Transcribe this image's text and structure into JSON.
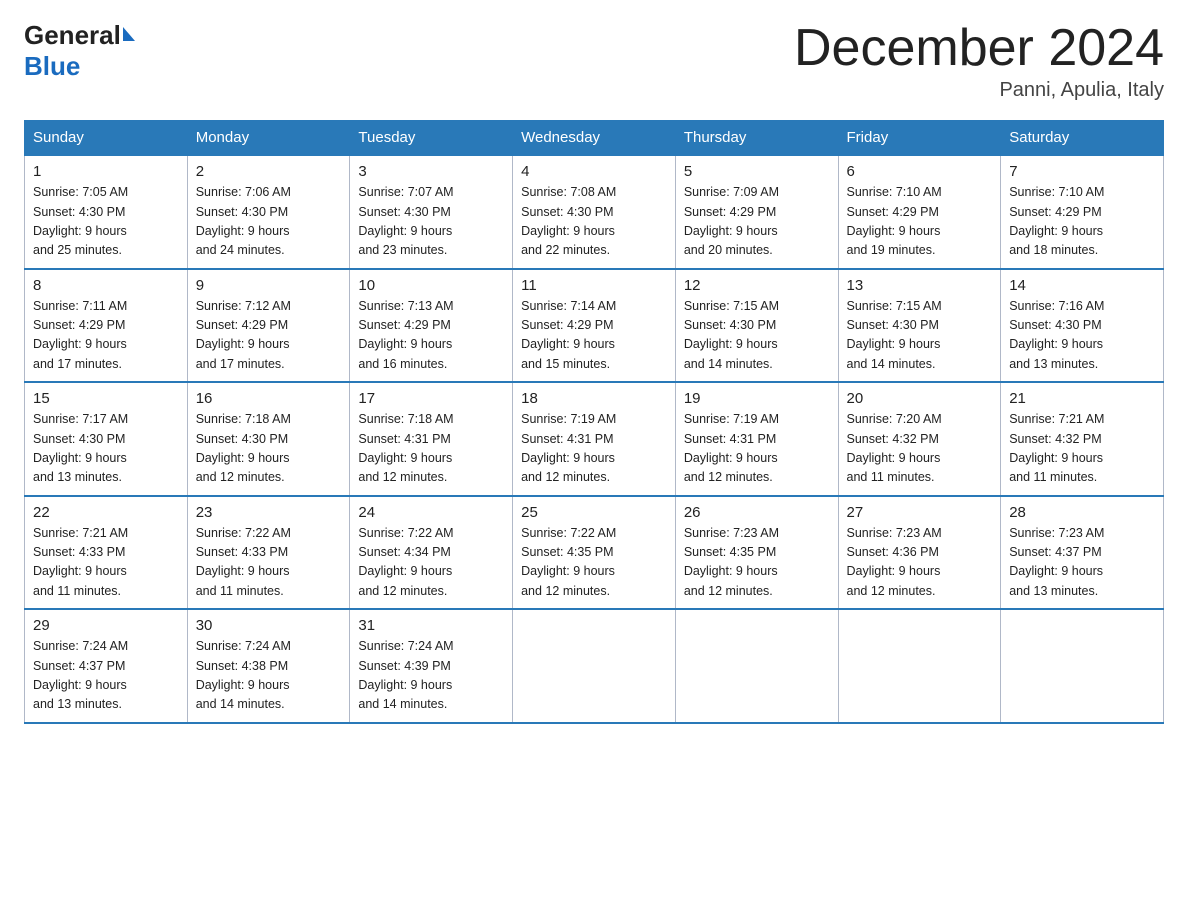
{
  "header": {
    "logo_general": "General",
    "logo_blue": "Blue",
    "month_title": "December 2024",
    "location": "Panni, Apulia, Italy"
  },
  "days_of_week": [
    "Sunday",
    "Monday",
    "Tuesday",
    "Wednesday",
    "Thursday",
    "Friday",
    "Saturday"
  ],
  "weeks": [
    [
      {
        "day": "1",
        "sunrise": "7:05 AM",
        "sunset": "4:30 PM",
        "daylight": "9 hours and 25 minutes."
      },
      {
        "day": "2",
        "sunrise": "7:06 AM",
        "sunset": "4:30 PM",
        "daylight": "9 hours and 24 minutes."
      },
      {
        "day": "3",
        "sunrise": "7:07 AM",
        "sunset": "4:30 PM",
        "daylight": "9 hours and 23 minutes."
      },
      {
        "day": "4",
        "sunrise": "7:08 AM",
        "sunset": "4:30 PM",
        "daylight": "9 hours and 22 minutes."
      },
      {
        "day": "5",
        "sunrise": "7:09 AM",
        "sunset": "4:29 PM",
        "daylight": "9 hours and 20 minutes."
      },
      {
        "day": "6",
        "sunrise": "7:10 AM",
        "sunset": "4:29 PM",
        "daylight": "9 hours and 19 minutes."
      },
      {
        "day": "7",
        "sunrise": "7:10 AM",
        "sunset": "4:29 PM",
        "daylight": "9 hours and 18 minutes."
      }
    ],
    [
      {
        "day": "8",
        "sunrise": "7:11 AM",
        "sunset": "4:29 PM",
        "daylight": "9 hours and 17 minutes."
      },
      {
        "day": "9",
        "sunrise": "7:12 AM",
        "sunset": "4:29 PM",
        "daylight": "9 hours and 17 minutes."
      },
      {
        "day": "10",
        "sunrise": "7:13 AM",
        "sunset": "4:29 PM",
        "daylight": "9 hours and 16 minutes."
      },
      {
        "day": "11",
        "sunrise": "7:14 AM",
        "sunset": "4:29 PM",
        "daylight": "9 hours and 15 minutes."
      },
      {
        "day": "12",
        "sunrise": "7:15 AM",
        "sunset": "4:30 PM",
        "daylight": "9 hours and 14 minutes."
      },
      {
        "day": "13",
        "sunrise": "7:15 AM",
        "sunset": "4:30 PM",
        "daylight": "9 hours and 14 minutes."
      },
      {
        "day": "14",
        "sunrise": "7:16 AM",
        "sunset": "4:30 PM",
        "daylight": "9 hours and 13 minutes."
      }
    ],
    [
      {
        "day": "15",
        "sunrise": "7:17 AM",
        "sunset": "4:30 PM",
        "daylight": "9 hours and 13 minutes."
      },
      {
        "day": "16",
        "sunrise": "7:18 AM",
        "sunset": "4:30 PM",
        "daylight": "9 hours and 12 minutes."
      },
      {
        "day": "17",
        "sunrise": "7:18 AM",
        "sunset": "4:31 PM",
        "daylight": "9 hours and 12 minutes."
      },
      {
        "day": "18",
        "sunrise": "7:19 AM",
        "sunset": "4:31 PM",
        "daylight": "9 hours and 12 minutes."
      },
      {
        "day": "19",
        "sunrise": "7:19 AM",
        "sunset": "4:31 PM",
        "daylight": "9 hours and 12 minutes."
      },
      {
        "day": "20",
        "sunrise": "7:20 AM",
        "sunset": "4:32 PM",
        "daylight": "9 hours and 11 minutes."
      },
      {
        "day": "21",
        "sunrise": "7:21 AM",
        "sunset": "4:32 PM",
        "daylight": "9 hours and 11 minutes."
      }
    ],
    [
      {
        "day": "22",
        "sunrise": "7:21 AM",
        "sunset": "4:33 PM",
        "daylight": "9 hours and 11 minutes."
      },
      {
        "day": "23",
        "sunrise": "7:22 AM",
        "sunset": "4:33 PM",
        "daylight": "9 hours and 11 minutes."
      },
      {
        "day": "24",
        "sunrise": "7:22 AM",
        "sunset": "4:34 PM",
        "daylight": "9 hours and 12 minutes."
      },
      {
        "day": "25",
        "sunrise": "7:22 AM",
        "sunset": "4:35 PM",
        "daylight": "9 hours and 12 minutes."
      },
      {
        "day": "26",
        "sunrise": "7:23 AM",
        "sunset": "4:35 PM",
        "daylight": "9 hours and 12 minutes."
      },
      {
        "day": "27",
        "sunrise": "7:23 AM",
        "sunset": "4:36 PM",
        "daylight": "9 hours and 12 minutes."
      },
      {
        "day": "28",
        "sunrise": "7:23 AM",
        "sunset": "4:37 PM",
        "daylight": "9 hours and 13 minutes."
      }
    ],
    [
      {
        "day": "29",
        "sunrise": "7:24 AM",
        "sunset": "4:37 PM",
        "daylight": "9 hours and 13 minutes."
      },
      {
        "day": "30",
        "sunrise": "7:24 AM",
        "sunset": "4:38 PM",
        "daylight": "9 hours and 14 minutes."
      },
      {
        "day": "31",
        "sunrise": "7:24 AM",
        "sunset": "4:39 PM",
        "daylight": "9 hours and 14 minutes."
      },
      null,
      null,
      null,
      null
    ]
  ],
  "labels": {
    "sunrise": "Sunrise:",
    "sunset": "Sunset:",
    "daylight": "Daylight:"
  }
}
